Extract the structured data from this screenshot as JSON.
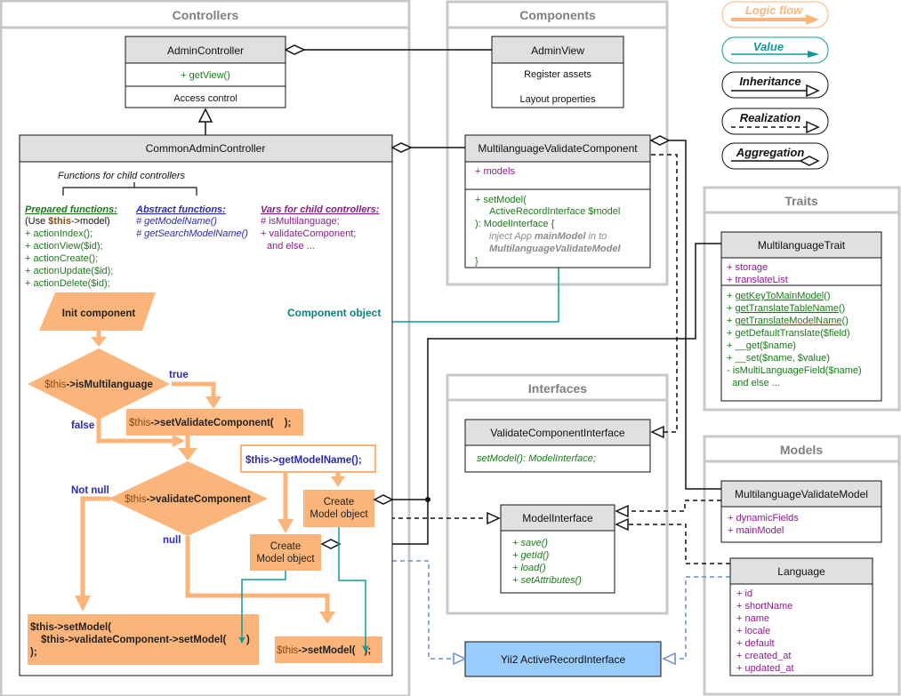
{
  "lanes": {
    "controllers": "Controllers",
    "components": "Components",
    "traits": "Traits",
    "interfaces": "Interfaces",
    "models": "Models"
  },
  "legend": {
    "logic_flow": "Logic flow",
    "value": "Value",
    "inheritance": "Inheritance",
    "realization": "Realization",
    "aggregation": "Aggregation"
  },
  "colors": {
    "logic_flow": "#fbb57a",
    "value": "#11999a",
    "class_header": "#e0e0e0",
    "lane_border": "#c8c8c8",
    "external_interface": "#99ccff"
  },
  "admin_controller": {
    "title": "AdminController",
    "methods": [
      "+ getView()"
    ],
    "notes": [
      "Access control"
    ]
  },
  "common_admin_controller": {
    "title": "CommonAdminController",
    "functions_caption": "Functions for child controllers",
    "prepared": {
      "heading": "Prepared functions:",
      "use_prefix": "(Use ",
      "use_this": "$this",
      "use_suffix": "->model)",
      "items": [
        "+ actionIndex();",
        "+ actionView($id);",
        "+ actionCreate();",
        "+ actionUpdate($id);",
        "+ actionDelete($id);"
      ]
    },
    "abstract": {
      "heading": "Abstract functions:",
      "items": [
        "# getModelName()",
        "# getSearchModelName()"
      ]
    },
    "vars": {
      "heading": "Vars for child controllers:",
      "items": [
        "# isMultilanguage;",
        "+ validateComponent;",
        "and else ..."
      ]
    }
  },
  "flow": {
    "init": "Init component",
    "is_multilanguage_pre": "$this",
    "is_multilanguage": "->isMultilanguage",
    "true_label": "true",
    "false_label": "false",
    "set_validate_pre": "$this",
    "set_validate": "->setValidateComponent(",
    "set_validate_end": ");",
    "get_model_name": "$this->getModelName();",
    "validate_component_pre": "$this",
    "validate_component": "->validateComponent",
    "not_null_label": "Not null",
    "null_label": "null",
    "create_model_1": [
      "Create",
      "Model object"
    ],
    "create_model_2": [
      "Create",
      "Model object"
    ],
    "set_model_complex": [
      "$this->setModel(",
      "$this->validateComponent->setModel(",
      ")",
      ");"
    ],
    "set_model_simple_pre": "$this",
    "set_model_simple": "->setModel(",
    "set_model_simple_end": ");",
    "component_object_label": "Component object"
  },
  "admin_view": {
    "title": "AdminView",
    "notes": [
      "Register assets",
      "Layout properties"
    ]
  },
  "multilanguage_validate_component": {
    "title": "MultilanguageValidateComponent",
    "fields": [
      "+ models"
    ],
    "method_lines": [
      "+ setModel(",
      "ActiveRecordInterface $model",
      "): ModelInterface {"
    ],
    "comment_1": "inject App ",
    "comment_bold": "mainModel",
    "comment_2": " in to",
    "comment_3": "MultilanguageValidateModel",
    "close": "}"
  },
  "multilanguage_trait": {
    "title": "MultilanguageTrait",
    "fields": [
      "+ storage",
      "+ translateList"
    ],
    "methods": [
      {
        "prefix": "+ ",
        "name": "getKeyToMainModel",
        "suffix": "()",
        "static": true
      },
      {
        "prefix": "+ ",
        "name": "getTranslateTableName",
        "suffix": "()",
        "static": true
      },
      {
        "prefix": "+ ",
        "name": "getTranslateModelName",
        "suffix": "()",
        "static": true
      },
      {
        "prefix": "+ ",
        "name": "getDefaultTranslate($field)",
        "suffix": "",
        "static": false
      },
      {
        "prefix": "+ ",
        "name": "__get($name)",
        "suffix": "",
        "static": false
      },
      {
        "prefix": "+ ",
        "name": "__set($name, $value)",
        "suffix": "",
        "static": false
      },
      {
        "prefix": "- ",
        "name": "isMultiLanguageField($name)",
        "suffix": "",
        "static": false
      },
      {
        "prefix": "  ",
        "name": "and else ...",
        "suffix": "",
        "static": false
      }
    ]
  },
  "validate_component_interface": {
    "title": "ValidateComponentInterface",
    "methods": [
      "setModel(): ModelInterface;"
    ]
  },
  "model_interface": {
    "title": "ModelInterface",
    "methods": [
      "+ save()",
      "+ getId()",
      "+ load()",
      "+ setAttributes()"
    ]
  },
  "multilanguage_validate_model": {
    "title": "MultilanguageValidateModel",
    "fields": [
      "+ dynamicFields",
      "+ mainModel"
    ]
  },
  "language": {
    "title": "Language",
    "fields": [
      "+ id",
      "+ shortName",
      "+ name",
      "+ locale",
      "+ default",
      "+ created_at",
      "+ updated_at"
    ]
  },
  "active_record_interface": {
    "title": "Yii2 ActiveRecordInterface"
  }
}
